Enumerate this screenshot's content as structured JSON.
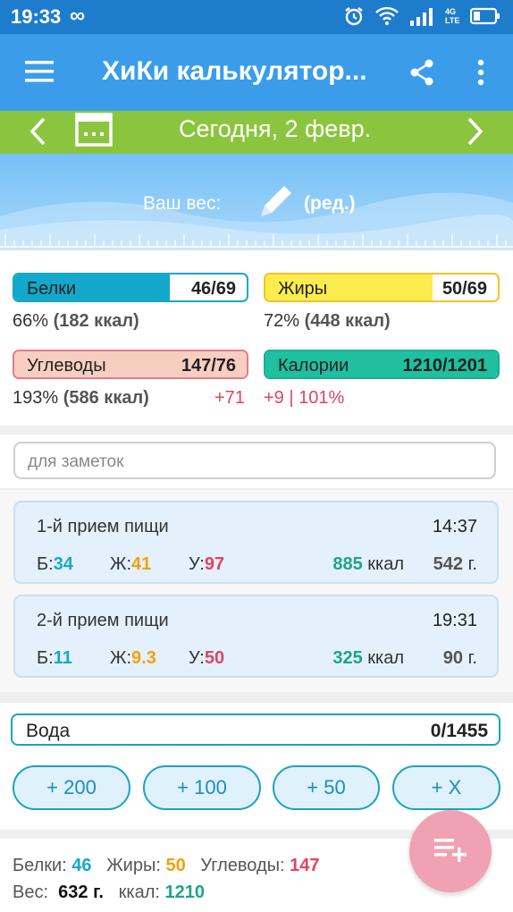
{
  "status_bar": {
    "time": "19:33",
    "infinity_icon": "∞",
    "network_label": "4G LTE",
    "icons": [
      "alarm-icon",
      "wifi-icon",
      "signal-icon",
      "battery-icon"
    ]
  },
  "toolbar": {
    "title": "ХиКи калькулятор...",
    "menu_icon": "menu-icon",
    "share_icon": "share-icon",
    "more_icon": "more-vertical-icon"
  },
  "date_bar": {
    "date": "Сегодня, 2 февр.",
    "prev_icon": "chevron-left-icon",
    "next_icon": "chevron-right-icon",
    "calendar_icon": "calendar-icon"
  },
  "weight": {
    "label": "Ваш вес:",
    "edit_label": "(ред.)",
    "pencil_icon": "pencil-icon"
  },
  "macros": {
    "protein": {
      "name": "Белки",
      "value": "46/69",
      "fill": 0.67,
      "sub_percent": "66%",
      "sub_kcal": "(182 ккал)",
      "color": "#13a8cb"
    },
    "fat": {
      "name": "Жиры",
      "value": "50/69",
      "fill": 0.72,
      "sub_percent": "72%",
      "sub_kcal": "(448 ккал)",
      "color": "#fdec4d"
    },
    "carbs": {
      "name": "Углеводы",
      "value": "147/76",
      "fill": 1.0,
      "sub_percent": "193%",
      "sub_kcal": "(586 ккал)",
      "extra": "+71",
      "color": "#f7cfc1"
    },
    "calories": {
      "name": "Калории",
      "value": "1210/1201",
      "fill": 1.0,
      "extra": "+9 | 101%",
      "color": "#1fbfa0"
    }
  },
  "notes": {
    "placeholder": "для заметок"
  },
  "meals": [
    {
      "name": "1-й прием пищи",
      "time": "14:37",
      "p_label": "Б:",
      "p": "34",
      "f_label": "Ж:",
      "f": "41",
      "c_label": "У:",
      "c": "97",
      "kcal": "885",
      "kcal_unit": "ккал",
      "grams": "542",
      "grams_unit": "г."
    },
    {
      "name": "2-й прием пищи",
      "time": "19:31",
      "p_label": "Б:",
      "p": "11",
      "f_label": "Ж:",
      "f": "9.3",
      "c_label": "У:",
      "c": "50",
      "kcal": "325",
      "kcal_unit": "ккал",
      "grams": "90",
      "grams_unit": "г."
    }
  ],
  "water": {
    "name": "Вода",
    "value": "0/1455",
    "buttons": [
      "+ 200",
      "+ 100",
      "+ 50",
      "+ X"
    ]
  },
  "summary": {
    "protein_label": "Белки:",
    "protein": "46",
    "fat_label": "Жиры:",
    "fat": "50",
    "carbs_label": "Углеводы:",
    "carbs": "147",
    "weight_label": "Вес:",
    "weight": "632 г.",
    "kcal_label": "ккал:",
    "kcal": "1210"
  },
  "fab": {
    "icon": "add-list-icon"
  }
}
